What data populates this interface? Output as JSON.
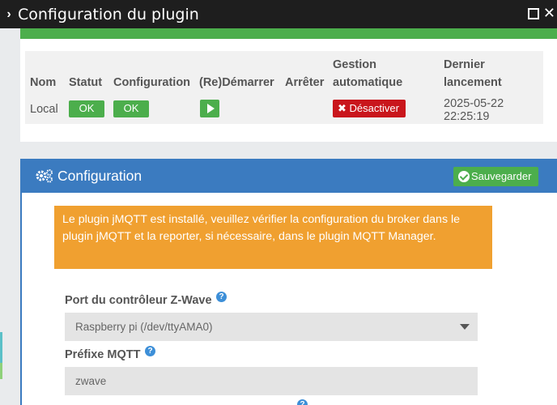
{
  "window": {
    "title": "Configuration du plugin"
  },
  "status_table": {
    "headers": {
      "name": "Nom",
      "status": "Statut",
      "config": "Configuration",
      "restart": "(Re)Démarrer",
      "stop": "Arrêter",
      "auto_line1": "Gestion",
      "auto_line2": "automatique",
      "last_line1": "Dernier",
      "last_line2": "lancement"
    },
    "row": {
      "name": "Local",
      "status": "OK",
      "config": "OK",
      "auto_label": "Désactiver",
      "last_date": "2025-05-22",
      "last_time": "22:25:19"
    }
  },
  "config_panel": {
    "title": "Configuration",
    "save_label": "Sauvegarder",
    "warning": "Le plugin jMQTT est installé, veuillez vérifier la configuration du broker dans le plugin jMQTT et la reporter, si nécessaire, dans le plugin MQTT Manager.",
    "port_label": "Port du contrôleur Z-Wave",
    "port_value": "Raspberry pi (/dev/ttyAMA0)",
    "prefix_label": "Préfixe MQTT",
    "prefix_value": "zwave"
  },
  "colors": {
    "titlebar": "#1e1e1e",
    "success": "#4cae4c",
    "danger": "#c9161c",
    "primary": "#3b7bc0",
    "warning": "#f0a030"
  }
}
